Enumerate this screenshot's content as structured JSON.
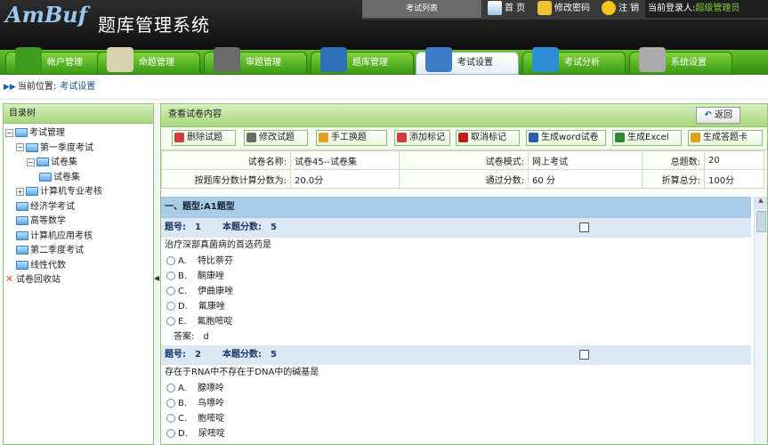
{
  "brand": {
    "logo": "AmBuf",
    "title": "题库管理系统"
  },
  "topnav": {
    "exam_list": "考试列表",
    "home": "首 页",
    "change_password": "修改密码",
    "logout": "注 销",
    "user_prefix": "当前登录人:",
    "user_name": "超级管理员"
  },
  "tabs": [
    {
      "label": "帐户管理",
      "icon": "users-icon",
      "color": "#3f9b1e"
    },
    {
      "label": "命题管理",
      "icon": "pencil-icon",
      "color": "#d8d2b0"
    },
    {
      "label": "审题管理",
      "icon": "tools-icon",
      "color": "#6a6a6a"
    },
    {
      "label": "题库管理",
      "icon": "books-icon",
      "color": "#2f6fb8"
    },
    {
      "label": "考试设置",
      "icon": "clock-settings-icon",
      "color": "#3b7cc7",
      "active": true
    },
    {
      "label": "考试分析",
      "icon": "chart-icon",
      "color": "#2c8fd6"
    },
    {
      "label": "系统设置",
      "icon": "wrench-icon",
      "color": "#aaaaaa"
    }
  ],
  "breadcrumb": {
    "prefix": "当前位置:",
    "current": "考试设置"
  },
  "tree": {
    "title": "目录树",
    "nodes": [
      {
        "label": "考试管理",
        "toggle": "−",
        "level": 0
      },
      {
        "label": "第一季度考试",
        "toggle": "−",
        "level": 1
      },
      {
        "label": "试卷集",
        "toggle": "−",
        "level": 2
      },
      {
        "label": "试卷集",
        "toggle": "",
        "level": 3
      },
      {
        "label": "计算机专业考核",
        "toggle": "+",
        "level": 1
      },
      {
        "label": "经济学考试",
        "toggle": "",
        "level": 1
      },
      {
        "label": "高等数学",
        "toggle": "",
        "level": 1
      },
      {
        "label": "计算机应用考核",
        "toggle": "",
        "level": 1
      },
      {
        "label": "第二季度考试",
        "toggle": "",
        "level": 1
      },
      {
        "label": "线性代数",
        "toggle": "",
        "level": 1
      },
      {
        "label": "试卷回收站",
        "toggle": "",
        "level": 0
      }
    ]
  },
  "main": {
    "title": "查看试卷内容",
    "back": "返回"
  },
  "toolbar": [
    {
      "label": "删除试题",
      "icon": "delete-icon",
      "color": "#d23c3c"
    },
    {
      "label": "修改试题",
      "icon": "edit-icon",
      "color": "#6a6a6a"
    },
    {
      "label": "手工换题",
      "icon": "swap-icon",
      "color": "#e0a020"
    },
    {
      "label": "添加标记",
      "icon": "add-mark-icon",
      "color": "#d23c3c"
    },
    {
      "label": "取消标记",
      "icon": "cancel-mark-icon",
      "color": "#c21e1e"
    },
    {
      "label": "生成word试卷",
      "icon": "word-icon",
      "color": "#2b5ea8"
    },
    {
      "label": "生成Excel",
      "icon": "excel-icon",
      "color": "#2d8a3a"
    },
    {
      "label": "生成答题卡",
      "icon": "card-icon",
      "color": "#e0a020"
    }
  ],
  "info": {
    "name_label": "试卷名称:",
    "name": "试卷45--试卷集",
    "mode_label": "试卷模式:",
    "mode": "网上考试",
    "total_label": "总题数:",
    "total": "20",
    "calc_label": "按题库分数计算分数为:",
    "calc": "20.0分",
    "pass_label": "通过分数:",
    "pass": "60 分",
    "converted_label": "折算总分:",
    "converted": "100分"
  },
  "section": "一、题型:A1题型",
  "questions": [
    {
      "no_label": "题号:",
      "no": "1",
      "score_label": "本题分数:",
      "score": "5",
      "stem": "治疗深部真菌病的首选药是",
      "options": [
        {
          "letter": "A.",
          "text": "特比萘芬"
        },
        {
          "letter": "B.",
          "text": "酮康唑"
        },
        {
          "letter": "C.",
          "text": "伊曲康唑"
        },
        {
          "letter": "D.",
          "text": "氟康唑"
        },
        {
          "letter": "E.",
          "text": "氟胞嘧啶"
        }
      ],
      "answer_label": "答案:",
      "answer": "d"
    },
    {
      "no_label": "题号:",
      "no": "2",
      "score_label": "本题分数:",
      "score": "5",
      "stem": "存在于RNA中不存在于DNA中的碱基是",
      "options": [
        {
          "letter": "A.",
          "text": "腺嘌呤"
        },
        {
          "letter": "B.",
          "text": "鸟嘌呤"
        },
        {
          "letter": "C.",
          "text": "胞嘧啶"
        },
        {
          "letter": "D.",
          "text": "尿嘧啶"
        }
      ]
    }
  ]
}
